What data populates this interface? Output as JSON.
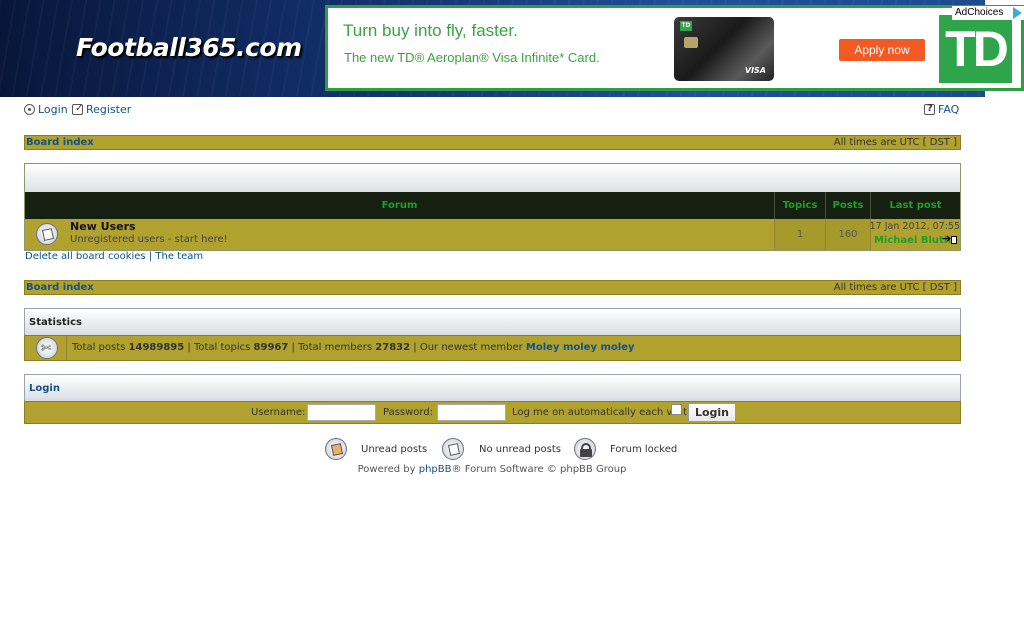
{
  "header": {
    "logo_text": "Football365.com"
  },
  "ad": {
    "headline": "Turn buy into fly, faster.",
    "sub": "The new TD® Aeroplan® Visa Infinite* Card.",
    "cta": "Apply now",
    "brand": "TD",
    "card_brand": "VISA",
    "adchoices": "AdChoices"
  },
  "topnav": {
    "login": "Login",
    "register": "Register",
    "faq": "FAQ"
  },
  "breadcrumb": {
    "label": "Board index",
    "times": "All times are UTC [ DST ]"
  },
  "forum_table": {
    "headers": {
      "forum": "Forum",
      "topics": "Topics",
      "posts": "Posts",
      "last_post": "Last post"
    },
    "rows": [
      {
        "title": "New Users",
        "description": "Unregistered users - start here!",
        "topics": "1",
        "posts": "160",
        "last_post_date": "17 Jan 2012, 07:55",
        "last_post_author": "Michael Bluth"
      }
    ]
  },
  "footer_links": {
    "delete_cookies": "Delete all board cookies",
    "separator": "|",
    "team": "The team"
  },
  "statistics": {
    "title": "Statistics",
    "posts_label": "Total posts",
    "posts_value": "14989895",
    "topics_label": "Total topics",
    "topics_value": "89967",
    "members_label": "Total members",
    "members_value": "27832",
    "newest_label": "Our newest member",
    "newest_member": "Moley moley moley"
  },
  "login_panel": {
    "title": "Login",
    "username_label": "Username:",
    "password_label": "Password:",
    "auto_login_label": "Log me on automatically each visit",
    "button": "Login"
  },
  "legend": {
    "unread": "Unread posts",
    "no_unread": "No unread posts",
    "locked": "Forum locked"
  },
  "powered": {
    "prefix": "Powered by",
    "phpbb": "phpBB",
    "suffix": "® Forum Software © phpBB Group"
  },
  "colors": {
    "olive": "#b1a22f",
    "link": "#105289",
    "header_green": "#1f9e2a",
    "ad_green": "#2ea54a",
    "cta_orange": "#f15a22"
  }
}
